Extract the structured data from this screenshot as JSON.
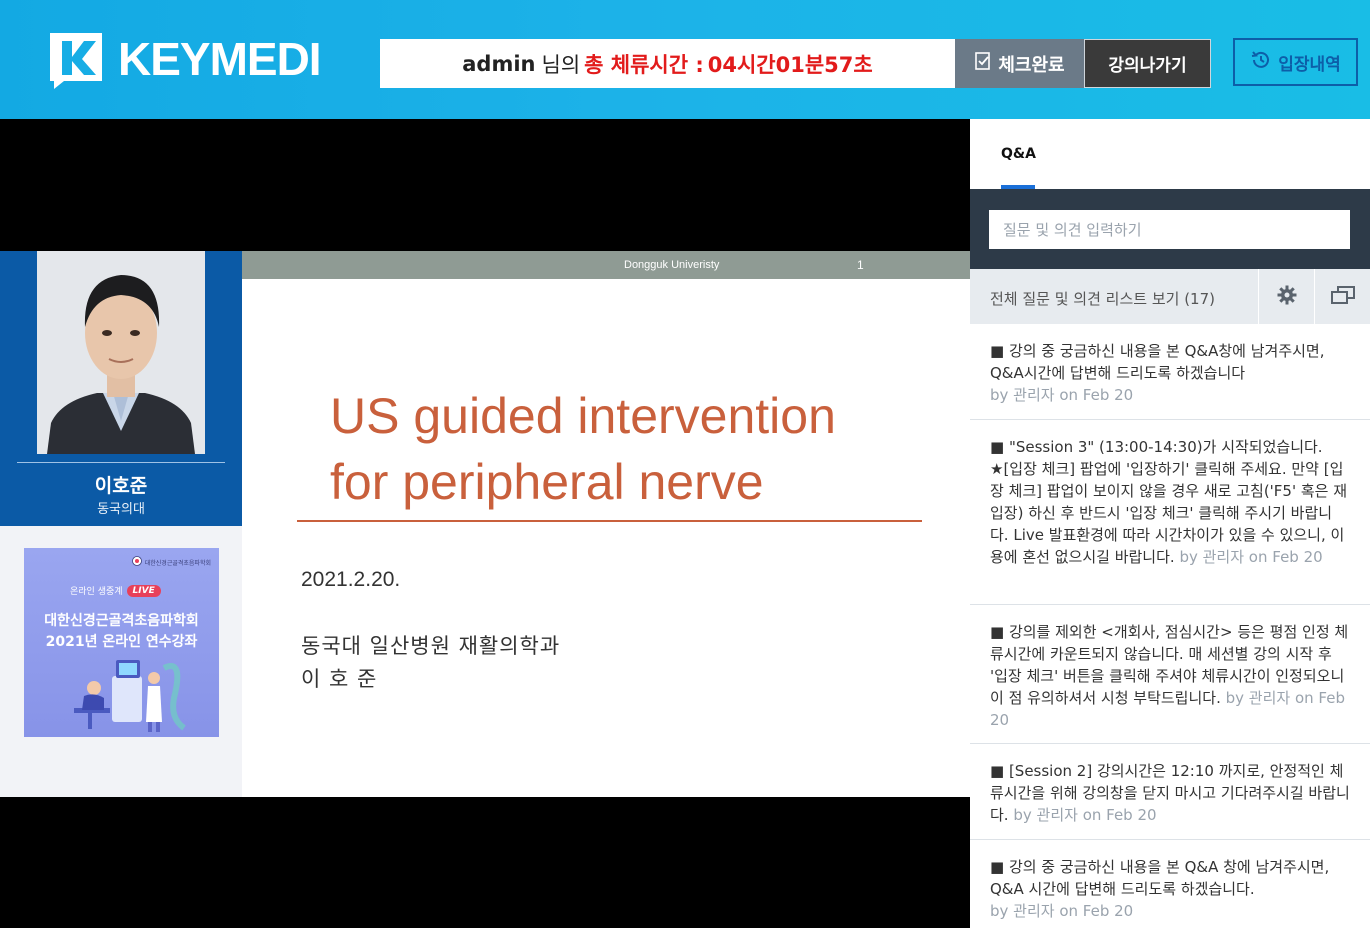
{
  "header": {
    "logo_text": "KEYMEDI",
    "timer": {
      "user": "admin",
      "user_suffix": "님의",
      "label": "총 체류시간 :",
      "value": "04시간01분57초"
    },
    "check_button": "체크완료",
    "exit_button": "강의나가기",
    "history_button": "입장내역"
  },
  "speaker": {
    "name": "이호준",
    "affiliation": "동국의대"
  },
  "promo": {
    "society": "대한신경근골격초음파학회",
    "live_label": "온라인 생중계",
    "live_badge": "LIVE",
    "title_line1": "대한신경근골격초음파학회",
    "title_line2": "2021년 온라인 연수강좌"
  },
  "slide": {
    "university": "Dongguk Univeristy",
    "page": "1",
    "title_line1": "US guided intervention",
    "title_line2": "for peripheral nerve",
    "date": "2021.2.20.",
    "department": "동국대 일산병원 재활의학과",
    "presenter": "이 호 준",
    "title_color": "#c9603c"
  },
  "qa": {
    "tab": "Q&A",
    "input_placeholder": "질문 및 의견 입력하기",
    "list_label": "전체 질문 및 의견 리스트 보기 (17)",
    "messages": [
      {
        "text": "■ 강의 중 궁금하신 내용을 본 Q&A창에 남겨주시면, Q&A시간에 답변해 드리도록 하겠습니다",
        "meta": "by 관리자 on Feb 20"
      },
      {
        "text": "■ \"Session 3\" (13:00-14:30)가 시작되었습니다. ★[입장 체크] 팝업에 '입장하기' 클릭해 주세요. 만약 [입장 체크] 팝업이 보이지 않을 경우 새로 고침('F5' 혹은 재입장) 하신 후 반드시 '입장 체크' 클릭해 주시기 바랍니다. Live 발표환경에 따라 시간차이가 있을 수 있으니, 이용에 혼선 없으시길 바랍니다.",
        "meta": "by 관리자 on Feb 20"
      },
      {
        "text": "■ 강의를 제외한 <개회사, 점심시간> 등은 평점 인정 체류시간에 카운트되지 않습니다. 매 세션별 강의 시작 후 '입장 체크' 버튼을 클릭해 주셔야 체류시간이 인정되오니 이 점 유의하셔서 시청 부탁드립니다.",
        "meta": "by 관리자 on Feb 20"
      },
      {
        "text": "■ [Session 2] 강의시간은 12:10 까지로, 안정적인 체류시간을 위해 강의창을 닫지 마시고 기다려주시길 바랍니다.",
        "meta": "by 관리자 on Feb 20"
      },
      {
        "text": "■ 강의 중 궁금하신 내용을 본 Q&A 창에 남겨주시면, Q&A 시간에 답변해 드리도록 하겠습니다.",
        "meta": "by 관리자 on Feb 20"
      }
    ]
  }
}
